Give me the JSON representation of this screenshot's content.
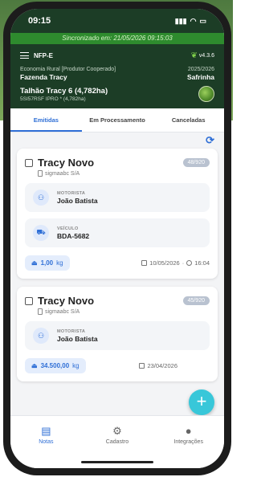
{
  "statusbar": {
    "time": "09:15"
  },
  "sync_banner": "Sincronizado em: 21/05/2026 09:15:03",
  "header": {
    "module": "NFP-E",
    "version": "v4.3.6",
    "org_type": "Economia Rural [Produtor Cooperado]",
    "farm": "Fazenda Tracy",
    "period": "2025/2026",
    "season": "Safrinha",
    "plot": "Talhão Tracy 6 (4,782ha)",
    "plot_sub": "5SI57RSF IPRO * (4,782ha)"
  },
  "tabs": [
    {
      "label": "Emitidas",
      "active": true
    },
    {
      "label": "Em Processamento",
      "active": false
    },
    {
      "label": "Canceladas",
      "active": false
    }
  ],
  "cards": [
    {
      "title": "Tracy Novo",
      "company": "sigmaabc S/A",
      "badge": "48/920",
      "driver_label": "MOTORISTA",
      "driver": "João Batista",
      "vehicle_label": "VEÍCULO",
      "vehicle": "BDA-5682",
      "weight": "1,00",
      "unit": "kg",
      "date": "10/05/2026",
      "time": "16:04"
    },
    {
      "title": "Tracy Novo",
      "company": "sigmaabc S/A",
      "badge": "45/920",
      "driver_label": "MOTORISTA",
      "driver": "João Batista",
      "weight": "34.500,00",
      "unit": "kg",
      "date": "23/04/2026"
    }
  ],
  "bottomnav": [
    {
      "label": "Notas",
      "icon": "notes-icon",
      "active": true
    },
    {
      "label": "Cadastro",
      "icon": "gear-icon",
      "active": false
    },
    {
      "label": "Integrações",
      "icon": "user-icon",
      "active": false
    }
  ],
  "colors": {
    "accent": "#2f6fd6",
    "header": "#1c3d26",
    "sync": "#2e8b2e",
    "fab": "#38c7d9"
  }
}
